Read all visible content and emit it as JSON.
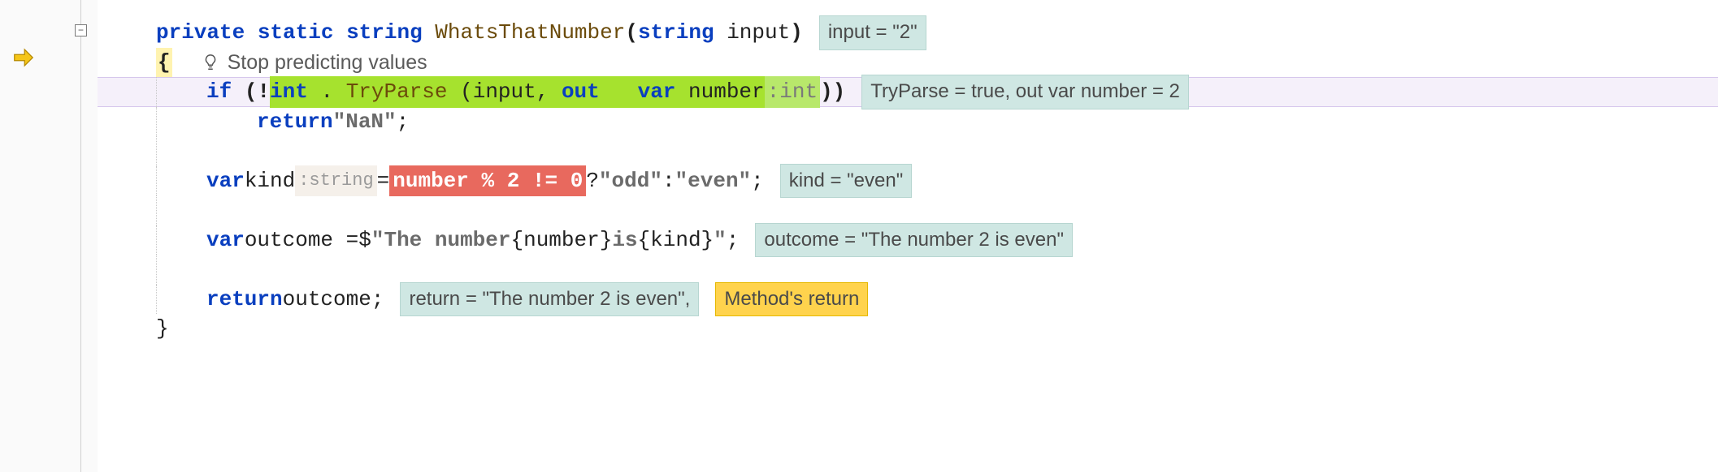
{
  "code": {
    "line1": {
      "kw_private": "private",
      "kw_static": "static",
      "kw_string": "string",
      "method_name": "WhatsThatNumber",
      "param_type": "string",
      "param_name": "input"
    },
    "line1_hint": "input = \"2\"",
    "brace_open": "{",
    "lens_text": "Stop predicting values",
    "line3": {
      "kw_if": "if",
      "not": "!",
      "int": "int",
      "dot": ".",
      "tryparse": "TryParse",
      "args": "(input, ",
      "kw_out": "out",
      "kw_var": "var",
      "number": " number",
      "type_hint": ":int",
      "close": "))"
    },
    "line3_hint": "TryParse = true,   out var number = 2",
    "line4": {
      "kw_return": "return",
      "nan": " \"NaN\"",
      "semi": ";"
    },
    "line5": {
      "kw_var": "var",
      "kind": " kind",
      "type_hint": ":string",
      "eq": " = ",
      "expr": "number % 2 != 0",
      "ternary": " ? ",
      "odd": "\"odd\"",
      "colon": " : ",
      "even": "\"even\"",
      "semi": ";"
    },
    "line5_hint": "kind = \"even\"",
    "line6": {
      "kw_var": "var",
      "outcome": " outcome = ",
      "dollar": "$",
      "str_open": "\"The number ",
      "interp1": "{number}",
      "str_mid": " is ",
      "interp2": "{kind}",
      "str_close": "\"",
      "semi": ";"
    },
    "line6_hint": "outcome = \"The number 2 is even\"",
    "line7": {
      "kw_return": "return",
      "outcome": " outcome",
      "semi": ";"
    },
    "line7_hint1": "return = \"The number 2 is even\",",
    "line7_hint2": "Method's return",
    "brace_close": "}"
  },
  "fold_glyph": "−"
}
